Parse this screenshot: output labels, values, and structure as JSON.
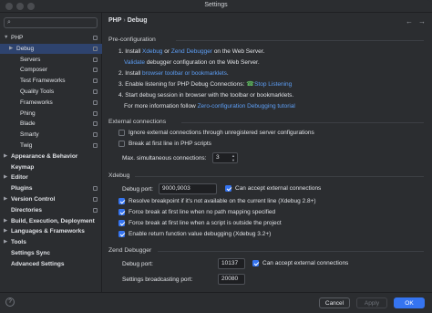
{
  "window": {
    "title": "Settings"
  },
  "sidebar": {
    "search_placeholder": "",
    "items": [
      {
        "label": "PHP",
        "expanded": true,
        "bold": false,
        "selected": false,
        "level": 0,
        "has_arrow": true,
        "has_grid": true
      },
      {
        "label": "Debug",
        "expanded": false,
        "bold": false,
        "selected": true,
        "level": 1,
        "has_arrow": true,
        "has_grid": true
      },
      {
        "label": "Servers",
        "level": 2,
        "has_grid": true
      },
      {
        "label": "Composer",
        "level": 2,
        "has_grid": true
      },
      {
        "label": "Test Frameworks",
        "level": 2,
        "has_grid": true
      },
      {
        "label": "Quality Tools",
        "level": 2,
        "has_grid": true
      },
      {
        "label": "Frameworks",
        "level": 2,
        "has_grid": true
      },
      {
        "label": "Phing",
        "level": 2,
        "has_grid": true
      },
      {
        "label": "Blade",
        "level": 2,
        "has_grid": true
      },
      {
        "label": "Smarty",
        "level": 2,
        "has_grid": true
      },
      {
        "label": "Twig",
        "level": 2,
        "has_grid": true
      },
      {
        "label": "Appearance & Behavior",
        "bold": true,
        "level": 0,
        "has_arrow": true
      },
      {
        "label": "Keymap",
        "bold": true,
        "level": 0
      },
      {
        "label": "Editor",
        "bold": true,
        "level": 0,
        "has_arrow": true
      },
      {
        "label": "Plugins",
        "bold": true,
        "level": 0,
        "has_grid": true
      },
      {
        "label": "Version Control",
        "bold": true,
        "level": 0,
        "has_arrow": true,
        "has_grid": true
      },
      {
        "label": "Directories",
        "bold": true,
        "level": 0,
        "has_grid": true
      },
      {
        "label": "Build, Execution, Deployment",
        "bold": true,
        "level": 0,
        "has_arrow": true
      },
      {
        "label": "Languages & Frameworks",
        "bold": true,
        "level": 0,
        "has_arrow": true
      },
      {
        "label": "Tools",
        "bold": true,
        "level": 0,
        "has_arrow": true
      },
      {
        "label": "Settings Sync",
        "bold": true,
        "level": 0
      },
      {
        "label": "Advanced Settings",
        "bold": true,
        "level": 0
      }
    ]
  },
  "main": {
    "breadcrumb": {
      "parent": "PHP",
      "separator": "›",
      "current": "Debug"
    },
    "nav": {
      "back": "←",
      "forward": "→"
    },
    "preconfig": {
      "heading": "Pre-configuration",
      "step1": {
        "prefix": "1. Install ",
        "link1": "Xdebug",
        "mid": " or ",
        "link2": "Zend Debugger",
        "suffix": " on the Web Server."
      },
      "step1b": {
        "link": "Validate",
        "suffix": " debugger configuration on the Web Server."
      },
      "step2": {
        "prefix": "2. Install ",
        "link": "browser toolbar or bookmarklets",
        "suffix": "."
      },
      "step3": {
        "prefix": "3. Enable listening for PHP Debug Connections: ",
        "link": "Stop Listening"
      },
      "step4": {
        "text": "4. Start debug session in browser with the toolbar or bookmarklets."
      },
      "step4b": {
        "prefix": "For more information follow ",
        "link": "Zero-configuration Debugging tutorial"
      }
    },
    "external": {
      "heading": "External connections",
      "ignore_label": "Ignore external connections through unregistered server configurations",
      "ignore_checked": false,
      "break_label": "Break at first line in PHP scripts",
      "break_checked": false,
      "max_label": "Max. simultaneous connections:",
      "max_value": "3"
    },
    "xdebug": {
      "heading": "Xdebug",
      "port_label": "Debug port:",
      "port_value": "9000,9003",
      "accept_label": "Can accept external connections",
      "accept_checked": true,
      "opt1": "Resolve breakpoint if it's not available on the current line (Xdebug 2.8+)",
      "opt2": "Force break at first line when no path mapping specified",
      "opt3": "Force break at first line when a script is outside the project",
      "opt4": "Enable return function value debugging (Xdebug 3.2+)",
      "opt_checked": [
        true,
        true,
        true,
        true
      ]
    },
    "zend": {
      "heading": "Zend Debugger",
      "port_label": "Debug port:",
      "port_value": "10137",
      "accept_label": "Can accept external connections",
      "accept_checked": true,
      "broadcast_label": "Settings broadcasting port:",
      "broadcast_value": "20080"
    }
  },
  "footer": {
    "help": "?",
    "cancel": "Cancel",
    "apply": "Apply",
    "ok": "OK"
  },
  "colors": {
    "accent": "#3574f0",
    "link": "#5d9ef5",
    "selected": "#2e436e",
    "background": "#2b2d30"
  }
}
